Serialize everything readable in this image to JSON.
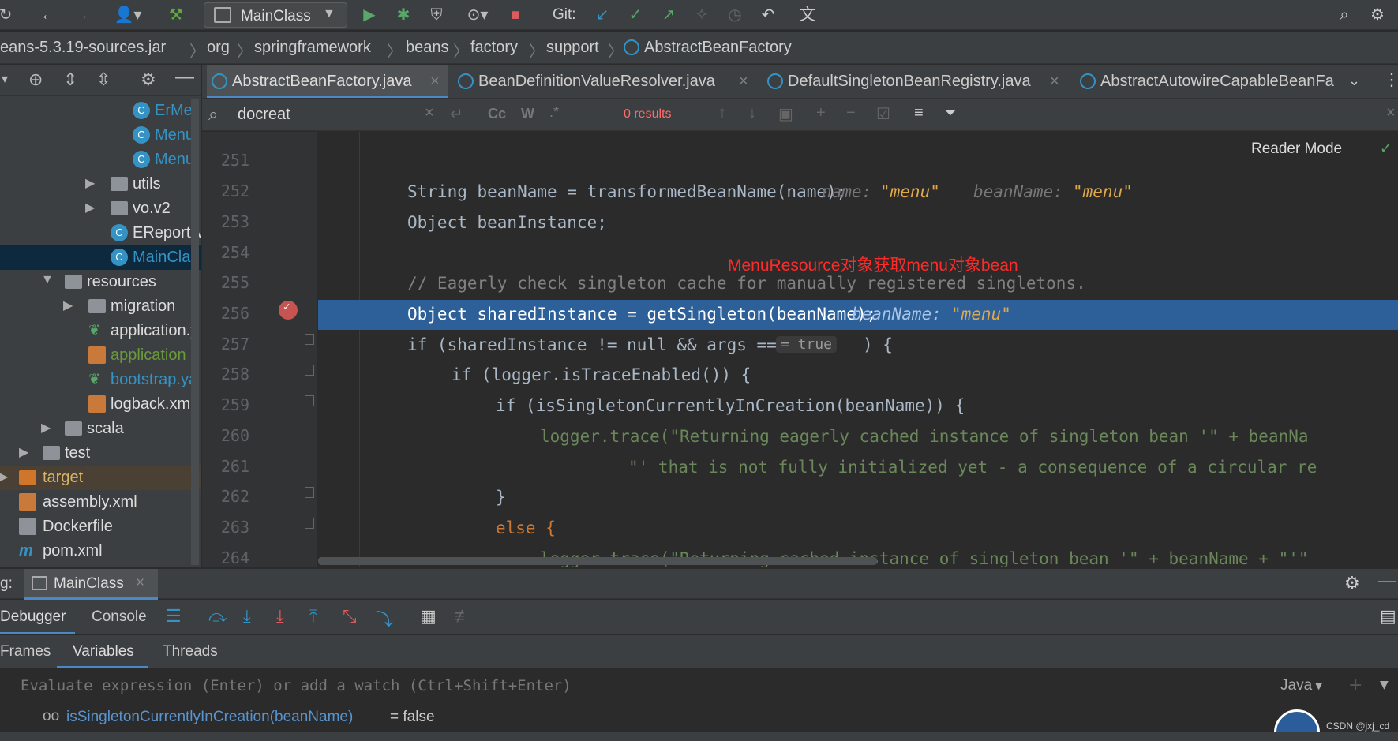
{
  "toolbar": {
    "run_config": "MainClass",
    "git_label": "Git:"
  },
  "breadcrumb": [
    "eans-5.3.19-sources.jar",
    "org",
    "springframework",
    "beans",
    "factory",
    "support",
    "AbstractBeanFactory"
  ],
  "project": {
    "items": [
      {
        "label": "ErMet",
        "kind": "class"
      },
      {
        "label": "Menu",
        "kind": "class"
      },
      {
        "label": "Menu",
        "kind": "class"
      },
      {
        "label": "utils",
        "kind": "folder"
      },
      {
        "label": "vo.v2",
        "kind": "folder"
      },
      {
        "label": "EReportA",
        "kind": "class"
      },
      {
        "label": "MainClas",
        "kind": "class"
      },
      {
        "label": "resources",
        "kind": "folder"
      },
      {
        "label": "migration",
        "kind": "folder"
      },
      {
        "label": "application.y",
        "kind": "yaml"
      },
      {
        "label": "application",
        "kind": "props"
      },
      {
        "label": "bootstrap.ya",
        "kind": "yaml"
      },
      {
        "label": "logback.xml",
        "kind": "xml"
      },
      {
        "label": "scala",
        "kind": "folder"
      },
      {
        "label": "test",
        "kind": "folder"
      },
      {
        "label": "target",
        "kind": "folder"
      },
      {
        "label": "assembly.xml",
        "kind": "xml"
      },
      {
        "label": "Dockerfile",
        "kind": "file"
      },
      {
        "label": "pom.xml",
        "kind": "maven"
      }
    ]
  },
  "editor": {
    "tabs": [
      "AbstractBeanFactory.java",
      "BeanDefinitionValueResolver.java",
      "DefaultSingletonBeanRegistry.java",
      "AbstractAutowireCapableBeanFa"
    ],
    "search_query": "docreat",
    "search_results": "0 results",
    "reader_mode": "Reader Mode",
    "annotation": "MenuResource对象获取menu对象bean",
    "lines": [
      {
        "n": "251"
      },
      {
        "n": "252",
        "code": "String beanName = transformedBeanName(name);",
        "hint1k": "name:",
        "hint1v": "\"menu\"",
        "hint2k": "beanName:",
        "hint2v": "\"menu\""
      },
      {
        "n": "253",
        "code": "Object beanInstance;"
      },
      {
        "n": "254"
      },
      {
        "n": "255",
        "code": "// Eagerly check singleton cache for manually registered singletons."
      },
      {
        "n": "256",
        "code": "Object sharedInstance = getSingleton(beanName);",
        "hint1k": "beanName:",
        "hint1v": "\"menu\""
      },
      {
        "n": "257",
        "code": "if (sharedInstance != null && args == null",
        "inline": "= true",
        "tail": ") {"
      },
      {
        "n": "258",
        "code": "if (logger.isTraceEnabled()) {"
      },
      {
        "n": "259",
        "code": "if (isSingletonCurrentlyInCreation(beanName)) {"
      },
      {
        "n": "260",
        "code": "logger.trace(\"Returning eagerly cached instance of singleton bean '\" + beanNa"
      },
      {
        "n": "261",
        "code": "\"' that is not fully initialized yet - a consequence of a circular re"
      },
      {
        "n": "262",
        "code": "}"
      },
      {
        "n": "263",
        "code": "else {"
      },
      {
        "n": "264",
        "code": "logger.trace(\"Returning cached instance of singleton bean '\" + beanName + \"'\""
      }
    ]
  },
  "debug": {
    "prefix": "g:",
    "session": "MainClass",
    "tabs": [
      "Debugger",
      "Console"
    ],
    "subtabs": [
      "Frames",
      "Variables",
      "Threads"
    ],
    "eval_placeholder": "Evaluate expression (Enter) or add a watch (Ctrl+Shift+Enter)",
    "lang": "Java",
    "watch_name": "isSingletonCurrentlyInCreation(beanName)",
    "watch_value": "= false"
  },
  "watermark": "CSDN @jxj_cd"
}
